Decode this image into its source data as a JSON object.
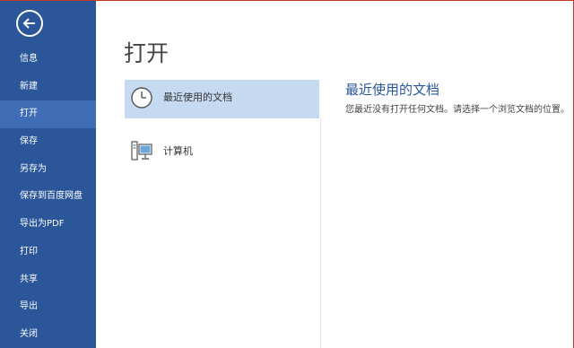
{
  "sidebar": {
    "back_icon": "back-arrow-icon",
    "items": [
      {
        "label": "信息"
      },
      {
        "label": "新建"
      },
      {
        "label": "打开"
      },
      {
        "label": "保存"
      },
      {
        "label": "另存为"
      },
      {
        "label": "保存到百度网盘"
      },
      {
        "label": "导出为PDF"
      },
      {
        "label": "打印"
      },
      {
        "label": "共享"
      },
      {
        "label": "导出"
      },
      {
        "label": "关闭"
      }
    ],
    "active_index": 2,
    "background_color": "#2b579a",
    "active_color": "#3f6db5"
  },
  "main": {
    "title": "打开",
    "places": [
      {
        "label": "最近使用的文档",
        "icon": "clock-icon",
        "selected": true
      },
      {
        "label": "计算机",
        "icon": "computer-icon",
        "selected": false
      }
    ],
    "selected_color": "#c5d9f1",
    "detail": {
      "title": "最近使用的文档",
      "text": "您最近没有打开任何文档。请选择一个浏览文档的位置。",
      "title_color": "#2b579a"
    }
  }
}
